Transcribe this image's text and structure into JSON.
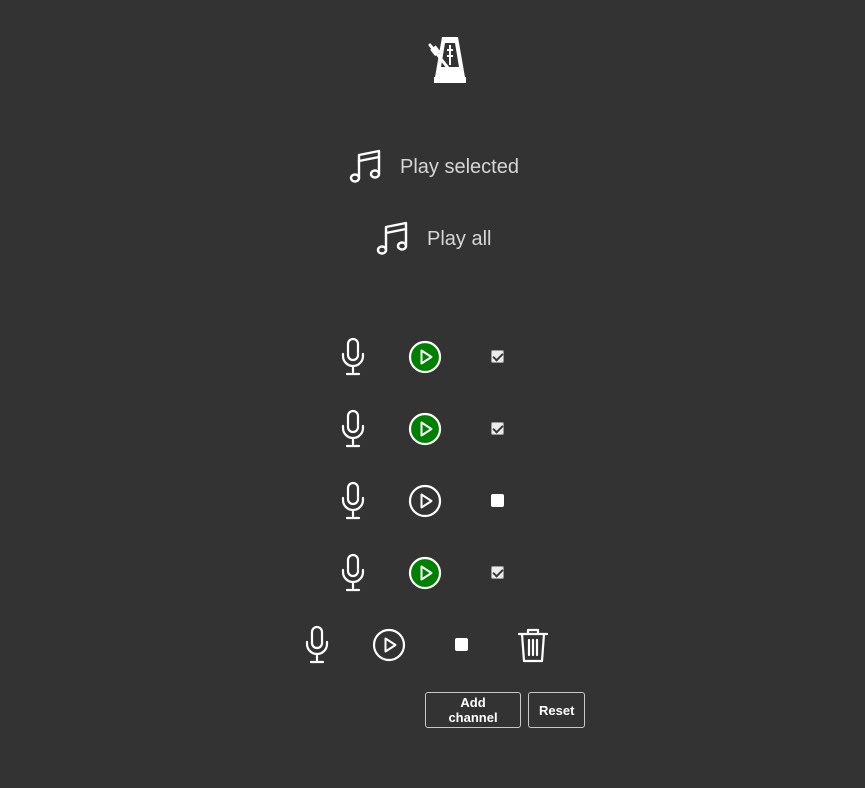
{
  "header": {
    "metronome_icon": "metronome-icon"
  },
  "playback": {
    "play_selected_label": "Play selected",
    "play_all_label": "Play all",
    "icon": "music-note-icon"
  },
  "channels": [
    {
      "record_icon": "microphone-icon",
      "play_icon": "play-icon",
      "playing": true,
      "selected": true,
      "deletable": false
    },
    {
      "record_icon": "microphone-icon",
      "play_icon": "play-icon",
      "playing": true,
      "selected": true,
      "deletable": false
    },
    {
      "record_icon": "microphone-icon",
      "play_icon": "play-icon",
      "playing": false,
      "selected": false,
      "deletable": false
    },
    {
      "record_icon": "microphone-icon",
      "play_icon": "play-icon",
      "playing": true,
      "selected": true,
      "deletable": false
    },
    {
      "record_icon": "microphone-icon",
      "play_icon": "play-icon",
      "playing": false,
      "selected": false,
      "deletable": true,
      "delete_icon": "trash-icon"
    }
  ],
  "controls": {
    "add_channel_label": "Add channel",
    "reset_label": "Reset"
  },
  "colors": {
    "background": "#333333",
    "active_play": "#008000",
    "foreground": "#ffffff",
    "label": "#d6d6d6"
  }
}
